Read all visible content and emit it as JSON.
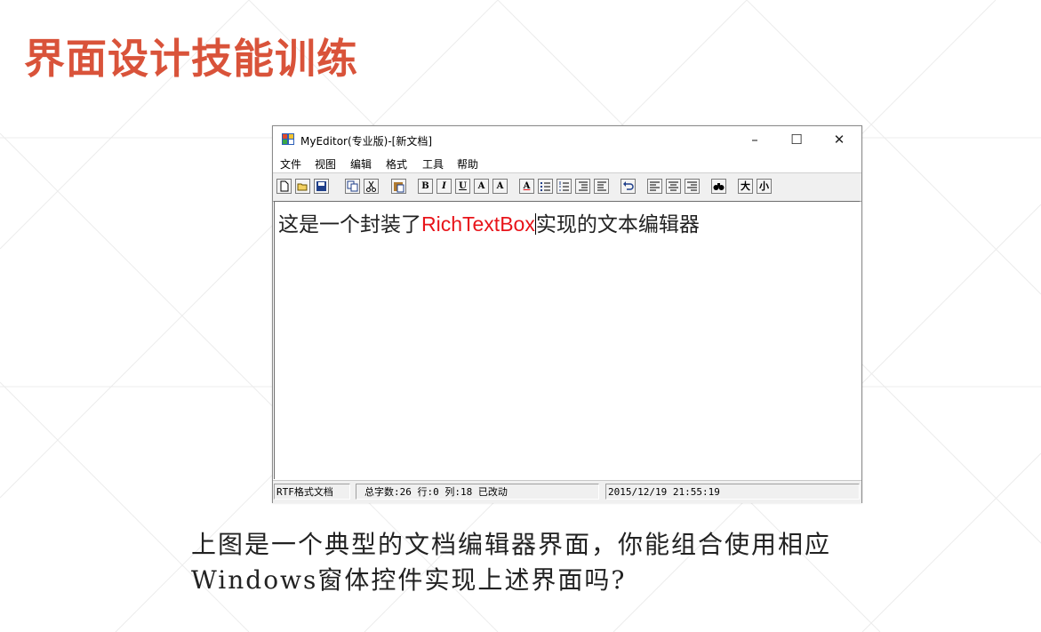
{
  "slide": {
    "title": "界面设计技能训练",
    "question_line1": "上图是一个典型的文档编辑器界面，你能组合使用相应",
    "question_line2": "Windows窗体控件实现上述界面吗?"
  },
  "window": {
    "title": "MyEditor(专业版)-[新文档]",
    "controls": {
      "minimize": "–",
      "maximize": "☐",
      "close": "✕"
    }
  },
  "menu": [
    "文件",
    "视图",
    "编辑",
    "格式",
    "工具",
    "帮助"
  ],
  "toolbar": {
    "buttons": [
      {
        "name": "new-icon",
        "glyph": ""
      },
      {
        "name": "open-icon",
        "glyph": ""
      },
      {
        "name": "save-icon",
        "glyph": ""
      },
      {
        "name": "copy-icon",
        "glyph": ""
      },
      {
        "name": "cut-icon",
        "glyph": ""
      },
      {
        "name": "paste-icon",
        "glyph": ""
      },
      {
        "name": "bold-icon",
        "glyph": "B"
      },
      {
        "name": "italic-icon",
        "glyph": "I"
      },
      {
        "name": "underline-icon",
        "glyph": "U"
      },
      {
        "name": "font-grow-icon",
        "glyph": "A"
      },
      {
        "name": "font-shrink-icon",
        "glyph": "A"
      },
      {
        "name": "font-color-icon",
        "glyph": "A"
      },
      {
        "name": "bullet-list-icon",
        "glyph": ""
      },
      {
        "name": "numbered-list-icon",
        "glyph": ""
      },
      {
        "name": "indent-icon",
        "glyph": ""
      },
      {
        "name": "outdent-icon",
        "glyph": ""
      },
      {
        "name": "undo-icon",
        "glyph": ""
      },
      {
        "name": "align-left-icon",
        "glyph": ""
      },
      {
        "name": "align-center-icon",
        "glyph": ""
      },
      {
        "name": "align-right-icon",
        "glyph": ""
      },
      {
        "name": "find-icon",
        "glyph": ""
      },
      {
        "name": "big-font-icon",
        "glyph": "大"
      },
      {
        "name": "small-font-icon",
        "glyph": "小"
      }
    ]
  },
  "editor": {
    "text_before": "这是一个封装了",
    "text_highlight": "RichTextBox",
    "text_after": "实现的文本编辑器",
    "highlight_color": "#e8141a"
  },
  "status": {
    "format": "RTF格式文档",
    "info": "总字数:26 行:0 列:18  已改动",
    "datetime": "2015/12/19 21:55:19"
  },
  "colors": {
    "title": "#d9533a"
  }
}
